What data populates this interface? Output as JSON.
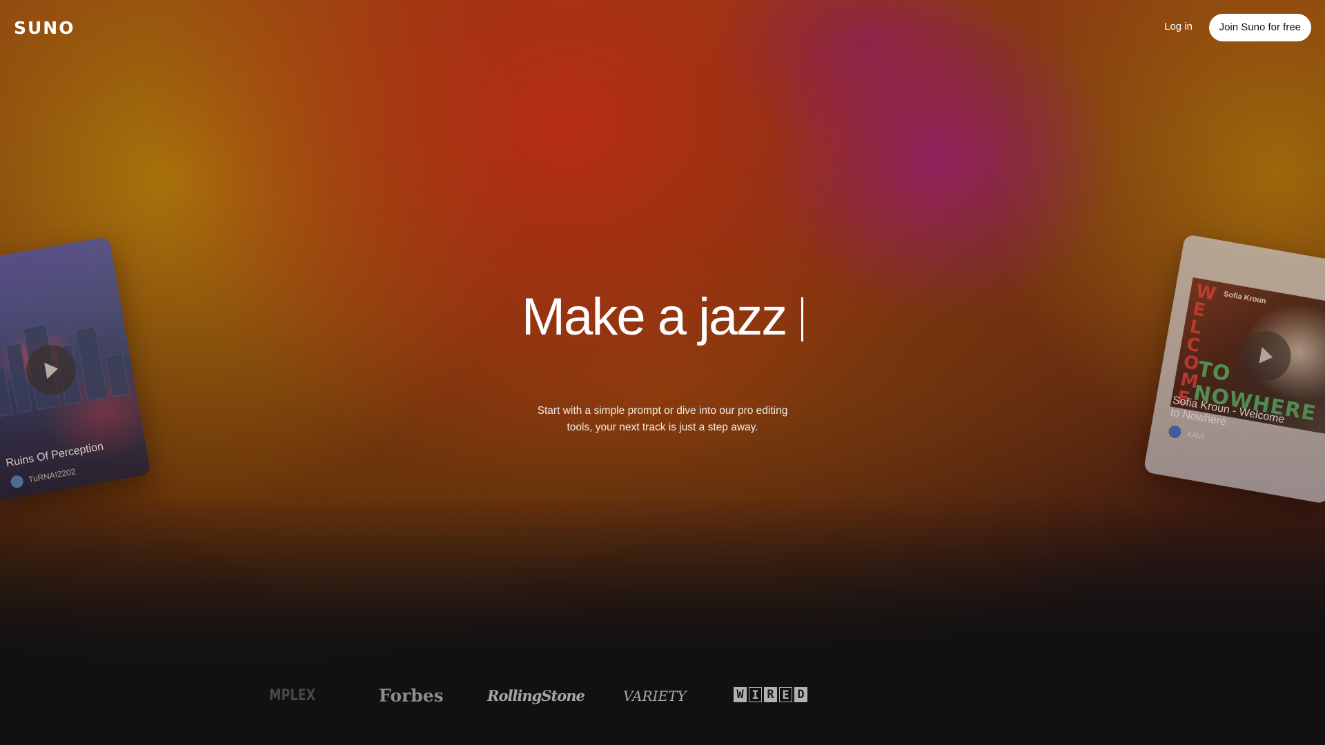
{
  "header": {
    "logo": "SUNO",
    "login_label": "Log in",
    "join_label": "Join Suno for free"
  },
  "hero": {
    "title": "Make a jazz",
    "subtitle": "Start with a simple prompt or dive into our pro editing tools, your next track is just a step away."
  },
  "cards": [
    {
      "title": "Ruins Of Perception",
      "author": "TuRNAI2202",
      "icon": "play-icon"
    },
    {
      "title": "Sofia Kroun - Welcome to Nowhere",
      "author": "XAVI",
      "art_text_vertical": "WELCOME",
      "art_text_bottom": "TO NOWHERE",
      "art_artist_tag": "Sofia Kroun",
      "icon": "play-icon"
    }
  ],
  "press": {
    "complex": "MPLEX",
    "forbes": "Forbes",
    "rolling_stone": "RollingStone",
    "variety": "VARIETY",
    "wired": [
      "W",
      "I",
      "R",
      "E",
      "D"
    ]
  },
  "colors": {
    "join_button_bg": "#ffffff",
    "join_button_text": "#111111",
    "page_bottom": "#111012",
    "hero_text": "#ffffff"
  }
}
